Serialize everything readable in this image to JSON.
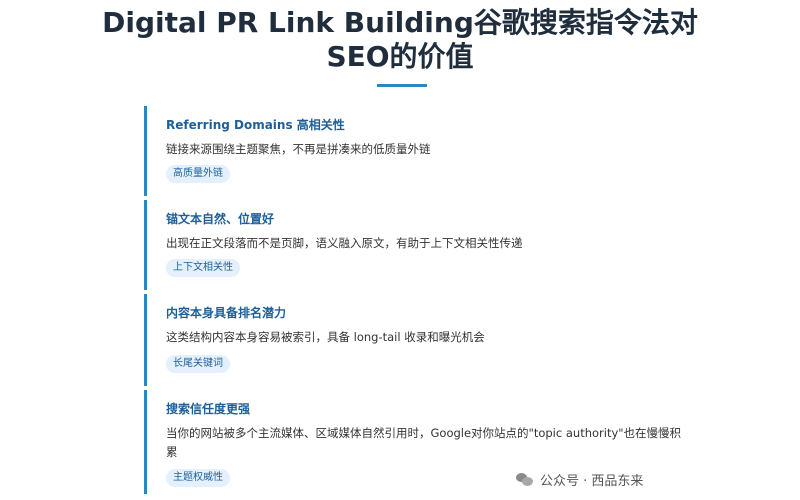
{
  "header": {
    "title_line1": "Digital PR Link Building谷歌搜索指令法对",
    "title_line2": "SEO的价值"
  },
  "cards": [
    {
      "title": "Referring Domains 高相关性",
      "desc": "链接来源围绕主题聚焦，不再是拼凑来的低质量外链",
      "tag": "高质量外链"
    },
    {
      "title": "锚文本自然、位置好",
      "desc": "出现在正文段落而不是页脚，语义融入原文，有助于上下文相关性传递",
      "tag": "上下文相关性"
    },
    {
      "title": "内容本身具备排名潜力",
      "desc": "这类结构内容本身容易被索引，具备 long-tail 收录和曝光机会",
      "tag": "长尾关键词"
    },
    {
      "title": "搜索信任度更强",
      "desc": "当你的网站被多个主流媒体、区域媒体自然引用时，Google对你站点的\"topic authority\"也在慢慢积累",
      "tag": "主题权威性"
    }
  ],
  "watermark": {
    "text": "公众号 · 西品东来",
    "icon": "wechat-icon"
  },
  "colors": {
    "accent": "#2e86c1",
    "title_text": "#1f2d3d",
    "card_title": "#1f5f99",
    "tag_bg": "#e4f0fb"
  }
}
